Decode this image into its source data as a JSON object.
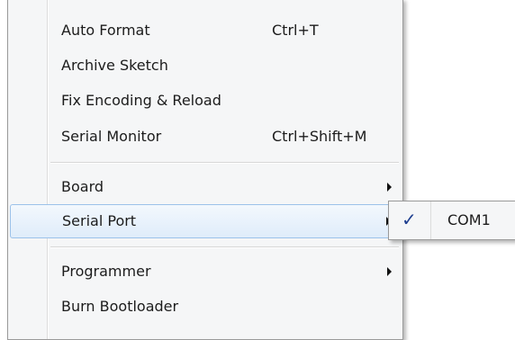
{
  "menu": {
    "items": [
      {
        "label": "Auto Format",
        "shortcut": "Ctrl+T"
      },
      {
        "label": "Archive Sketch",
        "shortcut": ""
      },
      {
        "label": "Fix Encoding & Reload",
        "shortcut": ""
      },
      {
        "label": "Serial Monitor",
        "shortcut": "Ctrl+Shift+M"
      },
      {
        "label": "Board",
        "submenu": true
      },
      {
        "label": "Serial Port",
        "submenu": true,
        "highlighted": true
      },
      {
        "label": "Programmer",
        "submenu": true
      },
      {
        "label": "Burn Bootloader"
      }
    ]
  },
  "submenu": {
    "items": [
      {
        "label": "COM1",
        "checked": true,
        "check_glyph": "✓"
      }
    ]
  },
  "colors": {
    "highlight_border": "#9cc2ea",
    "checkmark": "#1f3f8f"
  }
}
